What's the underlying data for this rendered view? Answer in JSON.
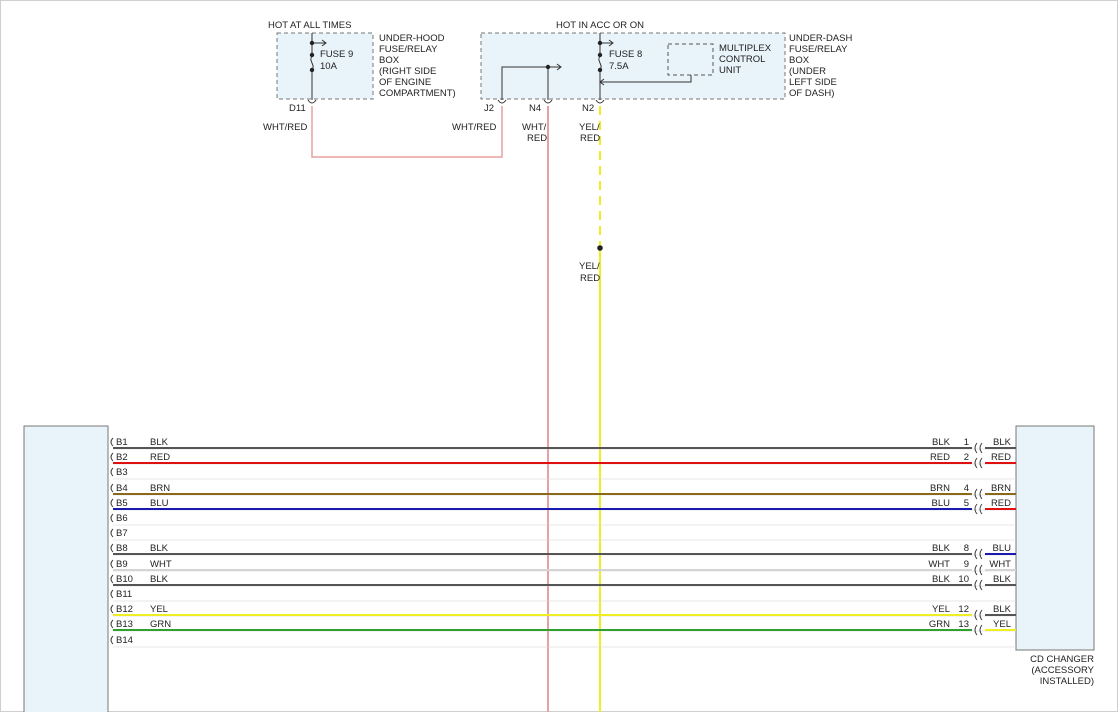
{
  "top": {
    "hot_at_all_times": "HOT AT ALL TIMES",
    "hot_in_acc": "HOT IN ACC OR ON"
  },
  "underhood_box": {
    "fuse_label": "FUSE 9",
    "fuse_rating": "10A",
    "name_lines": [
      "UNDER-HOOD",
      "FUSE/RELAY",
      "BOX",
      "(RIGHT SIDE",
      "OF ENGINE",
      "COMPARTMENT)"
    ],
    "terminal": "D11",
    "wire_color": "WHT/RED"
  },
  "underdash_box": {
    "fuse_label": "FUSE 8",
    "fuse_rating": "7.5A",
    "mcu_lines": [
      "MULTIPLEX",
      "CONTROL",
      "UNIT"
    ],
    "name_lines": [
      "UNDER-DASH",
      "FUSE/RELAY",
      "BOX",
      "(UNDER",
      "LEFT SIDE",
      "OF DASH)"
    ],
    "terminals": [
      "J2",
      "N4",
      "N2"
    ],
    "wire_j2": "WHT/RED",
    "wire_n4": [
      "WHT/",
      "RED"
    ],
    "wire_n2": [
      "YEL/",
      "RED"
    ],
    "wire_n2_lower": [
      "YEL/",
      "RED"
    ]
  },
  "left_pins": [
    "B1",
    "B2",
    "B3",
    "B4",
    "B5",
    "B6",
    "B7",
    "B8",
    "B9",
    "B10",
    "B11",
    "B12",
    "B13",
    "B14"
  ],
  "wires": [
    {
      "pin": "B1",
      "left_color": "BLK",
      "right_color": "BLK",
      "right_pin": "1",
      "cd_color": "BLK",
      "hex": "#555555",
      "cd_hex": "#555555"
    },
    {
      "pin": "B2",
      "left_color": "RED",
      "right_color": "RED",
      "right_pin": "2",
      "cd_color": "RED",
      "hex": "#e01010",
      "cd_hex": "#e01010"
    },
    {
      "pin": "B4",
      "left_color": "BRN",
      "right_color": "BRN",
      "right_pin": "4",
      "cd_color": "BRN",
      "hex": "#8a6a1a",
      "cd_hex": "#8a6a1a"
    },
    {
      "pin": "B5",
      "left_color": "BLU",
      "right_color": "BLU",
      "right_pin": "5",
      "cd_color": "RED",
      "hex": "#1a1ab0",
      "cd_hex": "#e01010"
    },
    {
      "pin": "B8",
      "left_color": "BLK",
      "right_color": "BLK",
      "right_pin": "8",
      "cd_color": "BLU",
      "hex": "#555555",
      "cd_hex": "#1a1ab0"
    },
    {
      "pin": "B9",
      "left_color": "WHT",
      "right_color": "WHT",
      "right_pin": "9",
      "cd_color": "WHT",
      "hex": "#d4d4d4",
      "cd_hex": "#d4d4d4"
    },
    {
      "pin": "B10",
      "left_color": "BLK",
      "right_color": "BLK",
      "right_pin": "10",
      "cd_color": "BLK",
      "hex": "#555555",
      "cd_hex": "#555555"
    },
    {
      "pin": "B12",
      "left_color": "YEL",
      "right_color": "YEL",
      "right_pin": "12",
      "cd_color": "BLK",
      "hex": "#eeee22",
      "cd_hex": "#555555"
    },
    {
      "pin": "B13",
      "left_color": "GRN",
      "right_color": "GRN",
      "right_pin": "13",
      "cd_color": "YEL",
      "hex": "#30a030",
      "cd_hex": "#eeee22"
    }
  ],
  "cd_changer": {
    "label_lines": [
      "CD CHANGER",
      "(ACCESSORY",
      "INSTALLED)"
    ]
  },
  "colors": {
    "box_fill": "#e8f3fa",
    "box_border": "#777777",
    "wht_red": "#e8a0a0",
    "yel_red": "#eeee22"
  }
}
